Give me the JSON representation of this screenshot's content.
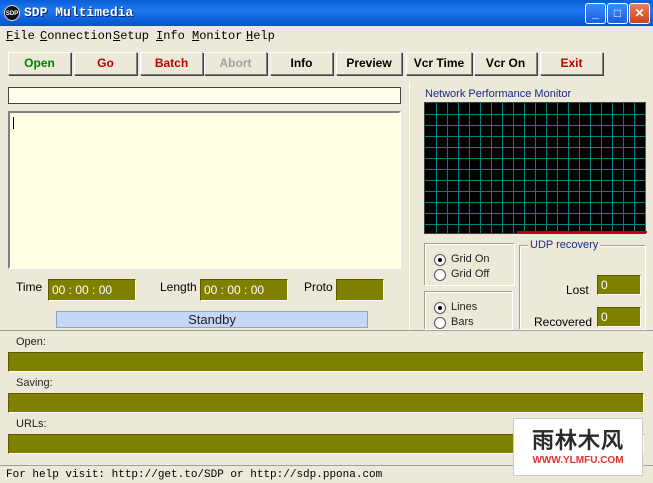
{
  "window": {
    "title": "SDP Multimedia",
    "icon_label": "SDP",
    "controls": [
      "minimize-icon",
      "maximize-icon",
      "close-icon"
    ]
  },
  "menu": [
    "File",
    "Connection",
    "Setup",
    "Info",
    "Monitor",
    "Help"
  ],
  "toolbar": [
    {
      "label": "Open",
      "color": "#008000",
      "enabled": true
    },
    {
      "label": "Go",
      "color": "#c00000",
      "enabled": true
    },
    {
      "label": "Batch",
      "color": "#c00000",
      "enabled": true
    },
    {
      "label": "Abort",
      "color": "#a0a0a0",
      "enabled": false
    },
    {
      "label": "Info",
      "color": "#000000",
      "enabled": true
    },
    {
      "label": "Preview",
      "color": "#000000",
      "enabled": true
    },
    {
      "label": "Vcr Time",
      "color": "#000000",
      "enabled": true
    },
    {
      "label": "Vcr On",
      "color": "#000000",
      "enabled": true
    },
    {
      "label": "Exit",
      "color": "#c00000",
      "enabled": true
    }
  ],
  "stream": {
    "url_value": "",
    "log_text": "",
    "time_label": "Time",
    "time_value": "00 : 00 : 00",
    "length_label": "Length",
    "length_value": "00 : 00 : 00",
    "proto_label": "Proto",
    "proto_value": "",
    "status": "Standby"
  },
  "monitor": {
    "title": "Network Performance Monitor",
    "grid_color": "#008080",
    "grid": true,
    "grid_mode": {
      "options": [
        "Grid On",
        "Grid Off"
      ],
      "selected": "Grid On"
    },
    "plot_mode": {
      "options": [
        "Lines",
        "Bars"
      ],
      "selected": "Lines"
    }
  },
  "udp": {
    "title": "UDP recovery",
    "lost_label": "Lost",
    "lost_value": "0",
    "recovered_label": "Recovered",
    "recovered_value": "0"
  },
  "progress": {
    "open_label": "Open:",
    "saving_label": "Saving:",
    "urls_label": "URLs:"
  },
  "statusbar": {
    "help_text": "For help visit: http://get.to/SDP or http://sdp.ppona.com"
  },
  "watermark": {
    "text": "雨林木风",
    "url": "WWW.YLMFU.COM"
  }
}
